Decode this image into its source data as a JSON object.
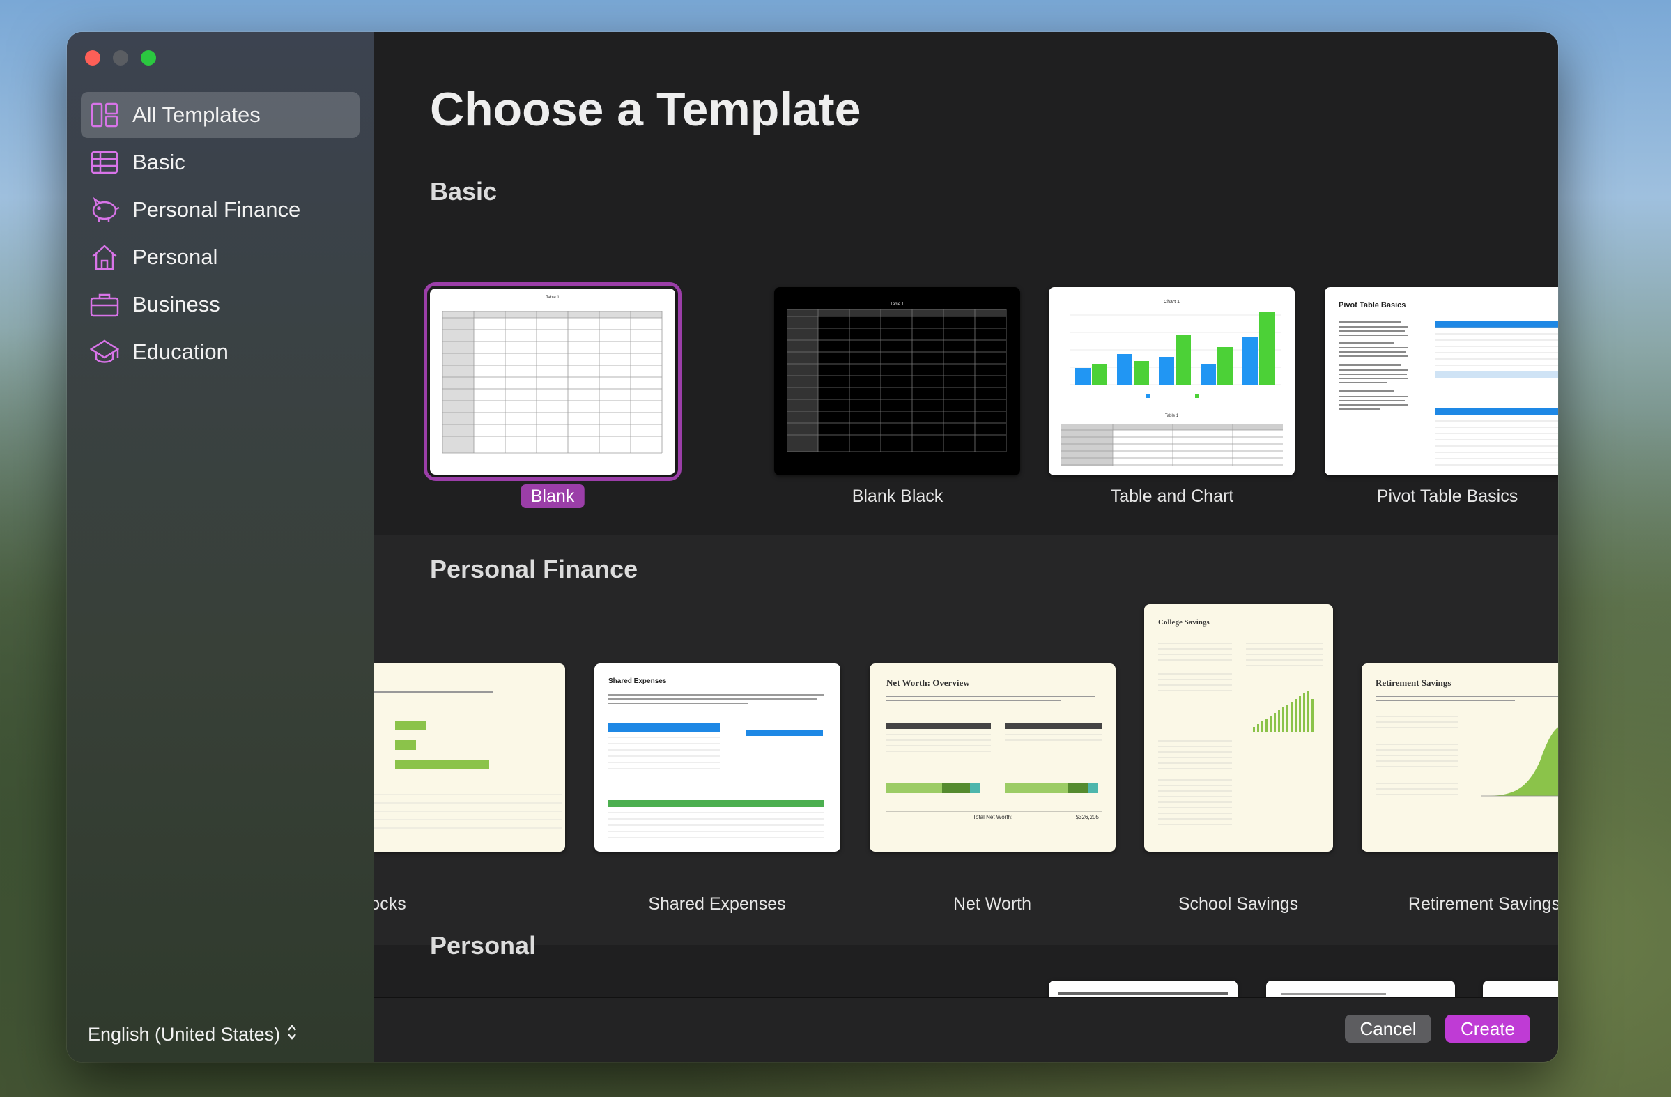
{
  "window": {
    "title": "Choose a Template"
  },
  "sidebar": {
    "items": [
      {
        "label": "All Templates",
        "icon": "all-templates-icon",
        "selected": true
      },
      {
        "label": "Basic",
        "icon": "table-grid-icon",
        "selected": false
      },
      {
        "label": "Personal Finance",
        "icon": "piggy-bank-icon",
        "selected": false
      },
      {
        "label": "Personal",
        "icon": "house-icon",
        "selected": false
      },
      {
        "label": "Business",
        "icon": "briefcase-icon",
        "selected": false
      },
      {
        "label": "Education",
        "icon": "graduation-cap-icon",
        "selected": false
      }
    ],
    "language": "English (United States)"
  },
  "sections": {
    "basic": {
      "title": "Basic",
      "templates": [
        {
          "label": "Blank",
          "selected": true,
          "preview_heading": "Table 1"
        },
        {
          "label": "Blank Black",
          "preview_heading": "Table 1"
        },
        {
          "label": "Table and Chart",
          "preview_heading": "Chart 1",
          "preview_subheading": "Table 1"
        },
        {
          "label": "Pivot Table Basics",
          "preview_heading": "Pivot Table Basics"
        }
      ]
    },
    "personal_finance": {
      "title": "Personal Finance",
      "templates": [
        {
          "label": "ocks"
        },
        {
          "label": "Shared Expenses",
          "preview_heading": "Shared Expenses"
        },
        {
          "label": "Net Worth",
          "preview_heading": "Net Worth: Overview",
          "preview_footer": "Total Net Worth:",
          "preview_value": "$326,205"
        },
        {
          "label": "School Savings",
          "preview_heading": "College Savings"
        },
        {
          "label": "Retirement Savings",
          "preview_heading": "Retirement Savings"
        }
      ]
    },
    "personal": {
      "title": "Personal"
    }
  },
  "footer": {
    "cancel": "Cancel",
    "create": "Create"
  },
  "colors": {
    "accent": "#9b3ea8",
    "create_button": "#bf3bd5",
    "sidebar_icon": "#d874e8"
  }
}
